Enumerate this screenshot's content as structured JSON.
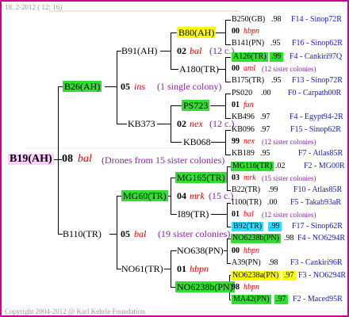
{
  "colors": {
    "frame": "#cc0099",
    "green": "#33dd33",
    "yellow": "#ffff00",
    "cyan": "#33ddff",
    "pink_bg": "#ffd0ff",
    "red": "#e00000",
    "purple": "#8822aa",
    "blue": "#1818c8"
  },
  "header": {
    "date": "18. 2-2012 ( 12: 16)"
  },
  "footer": {
    "copyright": "Copyright 2004-2012 @ Karl Kehrle Foundation."
  },
  "root": {
    "label": "B19(AH)"
  },
  "gen1": {
    "num": "08",
    "race": "bal",
    "note": "(Drones from 15 sister colonies)",
    "upper": "B26(AH)",
    "lower": "B110(TR)"
  },
  "gen2": {
    "a": {
      "num": "05",
      "race": "ins",
      "note": "(1 single colony)",
      "upper": "B91(AH)",
      "lower": "KB373"
    },
    "b": {
      "num": "05",
      "race": "bal",
      "note": "(19 sister colonies)",
      "upper": "MG60(TR)",
      "lower": "NO61(TR)"
    }
  },
  "gen3": [
    {
      "num": "02",
      "race": "bal",
      "note": "(12 c.)",
      "upper": "B80(AH)",
      "lower": "A180(TR)"
    },
    {
      "num": "02",
      "race": "nex",
      "note": "(12 c.)",
      "upper": "PS723",
      "lower": "KB068"
    },
    {
      "num": "04",
      "race": "mrk",
      "note": "(15 c.)",
      "upper": "MG165(TR)",
      "lower": "I89(TR)"
    },
    {
      "num": "01",
      "race": "hbpn",
      "note": "",
      "upper": "NO638(PN)",
      "lower": "NO6238b(PN)"
    }
  ],
  "leaves": [
    {
      "id": "B250(GB)",
      "val": ".98",
      "num": "",
      "race": "",
      "note": "",
      "ref": "F14 - Sinop72R"
    },
    {
      "id": "",
      "val": "",
      "num": "00",
      "race": "hbpn",
      "note": "",
      "ref": ""
    },
    {
      "id": "B141(PN)",
      "val": ".95",
      "num": "",
      "race": "",
      "note": "",
      "ref": "F16 - Sinop62R"
    },
    {
      "id": "A126(TR)",
      "val": ".99",
      "num": "",
      "race": "",
      "note": "",
      "ref": "F4 - Cankiri97Q"
    },
    {
      "id": "",
      "val": "",
      "num": "00",
      "race": "aml",
      "note": "(12 sister colonies)",
      "ref": ""
    },
    {
      "id": "B175(TR)",
      "val": ".95",
      "num": "",
      "race": "",
      "note": "",
      "ref": "F13 - Sinop72R"
    },
    {
      "id": "PS020",
      "val": ".00",
      "num": "",
      "race": "",
      "note": "",
      "ref": "F0 - Carpath00R"
    },
    {
      "id": "",
      "val": "",
      "num": "01",
      "race": "fun",
      "note": "",
      "ref": ""
    },
    {
      "id": "KB496",
      "val": ".97",
      "num": "",
      "race": "",
      "note": "",
      "ref": "F4 - Egypt94-2R"
    },
    {
      "id": "KB096",
      "val": ".97",
      "num": "",
      "race": "",
      "note": "",
      "ref": "F15 - Sinop62R"
    },
    {
      "id": "",
      "val": "",
      "num": "99",
      "race": "nex",
      "note": "(12 sister colonies)",
      "ref": ""
    },
    {
      "id": "KB189",
      "val": ".95",
      "num": "",
      "race": "",
      "note": "",
      "ref": "F7 - Atlas85R"
    },
    {
      "id": "MG116(TR)",
      "val": ".02",
      "num": "",
      "race": "",
      "note": "",
      "ref": "F2 - MG00R"
    },
    {
      "id": "",
      "val": "",
      "num": "03",
      "race": "mrk",
      "note": "(15 sister colonies)",
      "ref": ""
    },
    {
      "id": "B22(TR)",
      "val": ".99",
      "num": "",
      "race": "",
      "note": "",
      "ref": "F10 - Atlas85R"
    },
    {
      "id": "I100(TR)",
      "val": ".00",
      "num": "",
      "race": "",
      "note": "",
      "ref": "F5 - Takab93aR"
    },
    {
      "id": "",
      "val": "",
      "num": "01",
      "race": "bal",
      "note": "(12 sister colonies)",
      "ref": ""
    },
    {
      "id": "B92(TR)",
      "val": ".99",
      "num": "",
      "race": "",
      "note": "",
      "ref": "F17 - Sinop62R"
    },
    {
      "id": "NO6238b(PN)",
      "val": ".98",
      "num": "",
      "race": "",
      "note": "",
      "ref": "F4 - NO6294R"
    },
    {
      "id": "",
      "val": "",
      "num": "00",
      "race": "hbpn",
      "note": "",
      "ref": ""
    },
    {
      "id": "A39(PN)",
      "val": ".98",
      "num": "",
      "race": "",
      "note": "",
      "ref": "F3 - Cankiri96R"
    },
    {
      "id": "NO6238a(PN)",
      "val": ".97",
      "num": "",
      "race": "",
      "note": "",
      "ref": "F3 - NO6294R"
    },
    {
      "id": "",
      "val": "",
      "num": "98",
      "race": "hbpn",
      "note": "",
      "ref": ""
    },
    {
      "id": "MA42(PN)",
      "val": ".97",
      "num": "",
      "race": "",
      "note": "",
      "ref": "F2 - Maced95R"
    }
  ]
}
